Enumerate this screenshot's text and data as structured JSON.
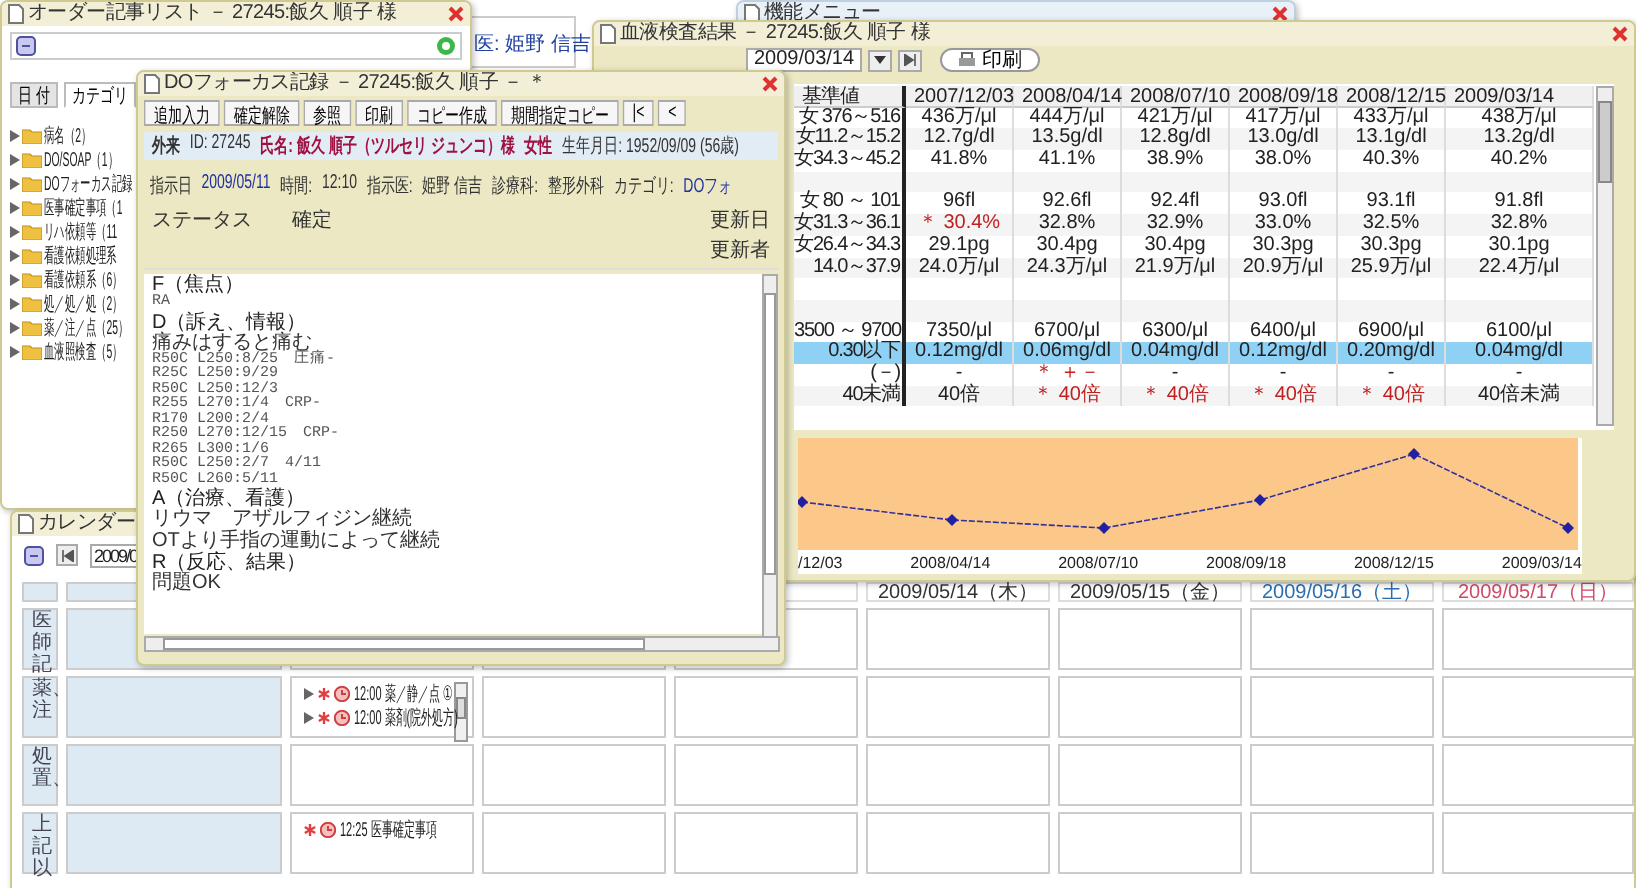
{
  "back_panel": {
    "doctor_label": "医: 姫野 信吉"
  },
  "order_window": {
    "title": "オーダー記事リスト － 27245:飯久 順子 様",
    "tabs": [
      {
        "label": "日 付",
        "selected": false
      },
      {
        "label": "カテゴリ",
        "selected": true
      }
    ],
    "categories": [
      {
        "label": "病名（2）"
      },
      {
        "label": "DO/SOAP（1）"
      },
      {
        "label": "DOフォーカス記録"
      },
      {
        "label": "医事確定事項（1"
      },
      {
        "label": "リハ依頼等（11"
      },
      {
        "label": "看護依頼処理系"
      },
      {
        "label": "看護依頼系（6）"
      },
      {
        "label": "処／処／処（2）"
      },
      {
        "label": "薬／注／点（25）"
      },
      {
        "label": "血液照検査（5）"
      }
    ]
  },
  "menu_window": {
    "title": "機能メニュー"
  },
  "calendar": {
    "title": "カレンダー",
    "date_field": "2009/0",
    "date_headers": [
      {
        "label": "2009/05/14（木）",
        "color": "#333333"
      },
      {
        "label": "2009/05/15（金）",
        "color": "#333333"
      },
      {
        "label": "2009/05/16（土）",
        "color": "#2a6fb0"
      },
      {
        "label": "2009/05/17（日）",
        "color": "#d04a6a"
      }
    ],
    "rows": [
      {
        "label": "医師記"
      },
      {
        "label": "薬、注",
        "events": [
          {
            "kind": "group",
            "text": "12:00 薬／静／点 ①"
          },
          {
            "kind": "group",
            "text": "12:00 薬剤(院外処方)"
          }
        ]
      },
      {
        "label": "処置、"
      },
      {
        "label": "上記以",
        "events": [
          {
            "kind": "single",
            "text": "12:25 医事確定事項"
          }
        ]
      }
    ]
  },
  "lab_window": {
    "title": "血液検査結果 － 27245:飯久 順子 様",
    "period_date": "2009/03/14",
    "print_label": "印刷",
    "columns": [
      "基準値",
      "2007/12/03",
      "2008/04/14",
      "2008/07/10",
      "2008/09/18",
      "2008/12/15",
      "2009/03/14"
    ],
    "rows": [
      {
        "kind": "data",
        "range": "女 376～516",
        "selected": false,
        "cells": [
          {
            "value": "436万/μl",
            "flagged": false
          },
          {
            "value": "444万/μl",
            "flagged": false
          },
          {
            "value": "421万/μl",
            "flagged": false
          },
          {
            "value": "417万/μl",
            "flagged": false
          },
          {
            "value": "433万/μl",
            "flagged": false
          },
          {
            "value": "438万/μl",
            "flagged": false
          }
        ]
      },
      {
        "kind": "data",
        "range": "女11.2～15.2",
        "selected": false,
        "cells": [
          {
            "value": "12.7g/dl",
            "flagged": false
          },
          {
            "value": "13.5g/dl",
            "flagged": false
          },
          {
            "value": "12.8g/dl",
            "flagged": false
          },
          {
            "value": "13.0g/dl",
            "flagged": false
          },
          {
            "value": "13.1g/dl",
            "flagged": false
          },
          {
            "value": "13.2g/dl",
            "flagged": false
          }
        ]
      },
      {
        "kind": "data",
        "range": "女34.3～45.2",
        "selected": false,
        "cells": [
          {
            "value": "41.8%",
            "flagged": false
          },
          {
            "value": "41.1%",
            "flagged": false
          },
          {
            "value": "38.9%",
            "flagged": false
          },
          {
            "value": "38.0%",
            "flagged": false
          },
          {
            "value": "40.3%",
            "flagged": false
          },
          {
            "value": "40.2%",
            "flagged": false
          }
        ]
      },
      {
        "kind": "spacer"
      },
      {
        "kind": "data",
        "range": "女 80 ～ 101",
        "selected": false,
        "cells": [
          {
            "value": "96fl",
            "flagged": false
          },
          {
            "value": "92.6fl",
            "flagged": false
          },
          {
            "value": "92.4fl",
            "flagged": false
          },
          {
            "value": "93.0fl",
            "flagged": false
          },
          {
            "value": "93.1fl",
            "flagged": false
          },
          {
            "value": "91.8fl",
            "flagged": false
          }
        ]
      },
      {
        "kind": "data",
        "range": "女31.3～36.1",
        "selected": false,
        "cells": [
          {
            "value": "＊ 30.4%",
            "flagged": true
          },
          {
            "value": "32.8%",
            "flagged": false
          },
          {
            "value": "32.9%",
            "flagged": false
          },
          {
            "value": "33.0%",
            "flagged": false
          },
          {
            "value": "32.5%",
            "flagged": false
          },
          {
            "value": "32.8%",
            "flagged": false
          }
        ]
      },
      {
        "kind": "data",
        "range": "女26.4～34.3",
        "selected": false,
        "cells": [
          {
            "value": "29.1pg",
            "flagged": false
          },
          {
            "value": "30.4pg",
            "flagged": false
          },
          {
            "value": "30.4pg",
            "flagged": false
          },
          {
            "value": "30.3pg",
            "flagged": false
          },
          {
            "value": "30.3pg",
            "flagged": false
          },
          {
            "value": "30.1pg",
            "flagged": false
          }
        ]
      },
      {
        "kind": "data",
        "range": "14.0～37.9",
        "selected": false,
        "cells": [
          {
            "value": "24.0万/μl",
            "flagged": false
          },
          {
            "value": "24.3万/μl",
            "flagged": false
          },
          {
            "value": "21.9万/μl",
            "flagged": false
          },
          {
            "value": "20.9万/μl",
            "flagged": false
          },
          {
            "value": "25.9万/μl",
            "flagged": false
          },
          {
            "value": "22.4万/μl",
            "flagged": false
          }
        ]
      },
      {
        "kind": "spacer"
      },
      {
        "kind": "spacer"
      },
      {
        "kind": "data",
        "range": "3500 ～ 9700",
        "selected": false,
        "cells": [
          {
            "value": "7350/μl",
            "flagged": false
          },
          {
            "value": "6700/μl",
            "flagged": false
          },
          {
            "value": "6300/μl",
            "flagged": false
          },
          {
            "value": "6400/μl",
            "flagged": false
          },
          {
            "value": "6900/μl",
            "flagged": false
          },
          {
            "value": "6100/μl",
            "flagged": false
          }
        ]
      },
      {
        "kind": "data",
        "range": "0.30以下",
        "selected": true,
        "cells": [
          {
            "value": "0.12mg/dl",
            "flagged": false
          },
          {
            "value": "0.06mg/dl",
            "flagged": false
          },
          {
            "value": "0.04mg/dl",
            "flagged": false
          },
          {
            "value": "0.12mg/dl",
            "flagged": false
          },
          {
            "value": "0.20mg/dl",
            "flagged": false
          },
          {
            "value": "0.04mg/dl",
            "flagged": false
          }
        ]
      },
      {
        "kind": "data",
        "range": "(－)",
        "selected": false,
        "cells": [
          {
            "value": "-",
            "flagged": false
          },
          {
            "value": "＊ ＋－",
            "flagged": true
          },
          {
            "value": "-",
            "flagged": false
          },
          {
            "value": "-",
            "flagged": false
          },
          {
            "value": "-",
            "flagged": false
          },
          {
            "value": "-",
            "flagged": false
          }
        ]
      },
      {
        "kind": "data",
        "range": "40未満",
        "selected": false,
        "cells": [
          {
            "value": "40倍",
            "flagged": false
          },
          {
            "value": "＊ 40倍",
            "flagged": true
          },
          {
            "value": "＊ 40倍",
            "flagged": true
          },
          {
            "value": "＊ 40倍",
            "flagged": true
          },
          {
            "value": "＊ 40倍",
            "flagged": true
          },
          {
            "value": "40倍未満",
            "flagged": false
          }
        ]
      }
    ],
    "chart_labels": [
      "/12/03",
      "2008/04/14",
      "2008/07/10",
      "2008/09/18",
      "2008/12/15",
      "2009/03/14"
    ]
  },
  "focus_window": {
    "title": "DOフォーカス記録 － 27245:飯久 順子 － ＊",
    "buttons": [
      "追加入力",
      "確定解除",
      "参照",
      "印刷",
      "コピー作成",
      "期間指定コピー",
      "|<",
      "<"
    ],
    "patient": {
      "visit": "外来",
      "id": "ID: 27245",
      "name": "氏名: 飯久 順子（ツルセリ ジュンコ）様",
      "sex": "女性",
      "birth": "生年月日: 1952/09/09 (56歳)"
    },
    "info": [
      {
        "label": "指示日",
        "value": "2009/05/11"
      },
      {
        "label": "時間:",
        "value": "12:10"
      },
      {
        "label": "指示医:",
        "value": "姫野 信吉"
      },
      {
        "label": "診療科:",
        "value": "整形外科"
      },
      {
        "label": "カテゴリ:",
        "value": "DOフォ"
      }
    ],
    "status": {
      "label": "ステータス",
      "value": "確定"
    },
    "meta_labels": [
      "更新日",
      "更新者"
    ],
    "sections": [
      {
        "heading": "F（焦点）",
        "lines": [
          {
            "kind": "code",
            "text": "RA"
          }
        ]
      },
      {
        "heading": "D（訴え、情報）",
        "lines": [
          {
            "kind": "text",
            "text": "痛みはすると痛む"
          },
          {
            "kind": "code",
            "text": "R50C L250:8/25　圧痛-"
          },
          {
            "kind": "code",
            "text": "R25C L250:9/29"
          },
          {
            "kind": "code",
            "text": "R50C L250:12/3"
          },
          {
            "kind": "code",
            "text": "R255 L270:1/4　CRP-"
          },
          {
            "kind": "code",
            "text": "R170 L200:2/4"
          },
          {
            "kind": "code",
            "text": "R250 L270:12/15　CRP-"
          },
          {
            "kind": "code",
            "text": "R265 L300:1/6"
          },
          {
            "kind": "code",
            "text": "R50C L250:2/7　4/11"
          },
          {
            "kind": "code",
            "text": "R50C L260:5/11"
          }
        ]
      },
      {
        "heading": "A（治療、看護）",
        "lines": [
          {
            "kind": "text",
            "text": "リウマ　アザルフィジン継続"
          }
        ]
      },
      {
        "lines": [
          {
            "kind": "text",
            "text": "OTより手指の運動によって継続"
          }
        ]
      },
      {
        "heading": "R（反応、結果）",
        "lines": [
          {
            "kind": "text",
            "text": "問題OK"
          }
        ]
      }
    ]
  }
}
